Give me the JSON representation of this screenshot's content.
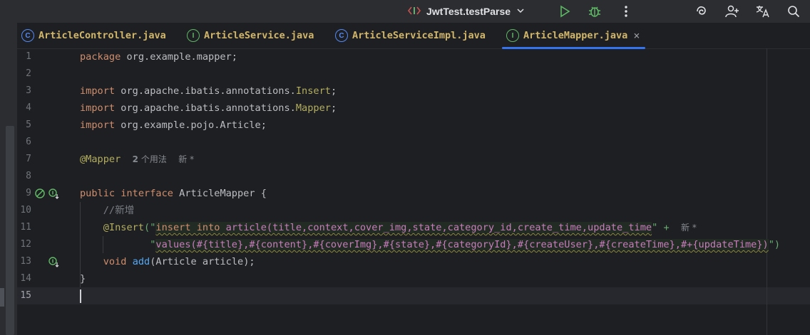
{
  "toolbar": {
    "run_config": "JwtTest.testParse"
  },
  "tabs": [
    {
      "label": "ArticleController.java",
      "kind": "C"
    },
    {
      "label": "ArticleService.java",
      "kind": "I"
    },
    {
      "label": "ArticleServiceImpl.java",
      "kind": "C"
    },
    {
      "label": "ArticleMapper.java",
      "kind": "I",
      "active": true
    }
  ],
  "editor": {
    "line_numbers": [
      "1",
      "2",
      "3",
      "4",
      "5",
      "6",
      "7",
      "8",
      "9",
      "10",
      "11",
      "12",
      "13",
      "14",
      "15"
    ],
    "current_line": "15",
    "l1": {
      "kw": "package",
      "rest": " org.example.mapper;"
    },
    "l3": {
      "kw": "import",
      "path": " org.apache.ibatis.annotations.",
      "cls": "Insert",
      "end": ";"
    },
    "l4": {
      "kw": "import",
      "path": " org.apache.ibatis.annotations.",
      "cls": "Mapper",
      "end": ";"
    },
    "l5": {
      "kw": "import",
      "rest": " org.example.pojo.Article;"
    },
    "l7": {
      "ann": "@Mapper",
      "hint_count": "2",
      "hint_usages": "个用法",
      "hint_new": "新 *"
    },
    "l9": {
      "kw1": "public",
      "kw2": "interface",
      "name": " ArticleMapper {"
    },
    "l10": {
      "comment": "//新增"
    },
    "l11": {
      "ann": "@Insert",
      "open": "(\"",
      "sql1": "insert into",
      "sql2": " article(title,context,cover_img,state,category_id,create_time,update_time",
      "close": "\" + ",
      "hint_new": "新 *"
    },
    "l12": {
      "open": "\"",
      "sql": "values(#{title},#{content},#{coverImg},#{state},#{categoryId},#{createUser},#{createTime},#+{updateTime})",
      "close": "\")"
    },
    "l13": {
      "kw": "void",
      "fn": "add",
      "rest": "(Article article);"
    },
    "l14": {
      "text": "}"
    }
  },
  "icons": {
    "run": "run-icon",
    "debug": "debug-icon",
    "more": "more-vertical-icon",
    "copilot": "ai-assistant-icon",
    "add_user": "add-user-icon",
    "translate": "translate-icon",
    "search": "search-icon"
  }
}
